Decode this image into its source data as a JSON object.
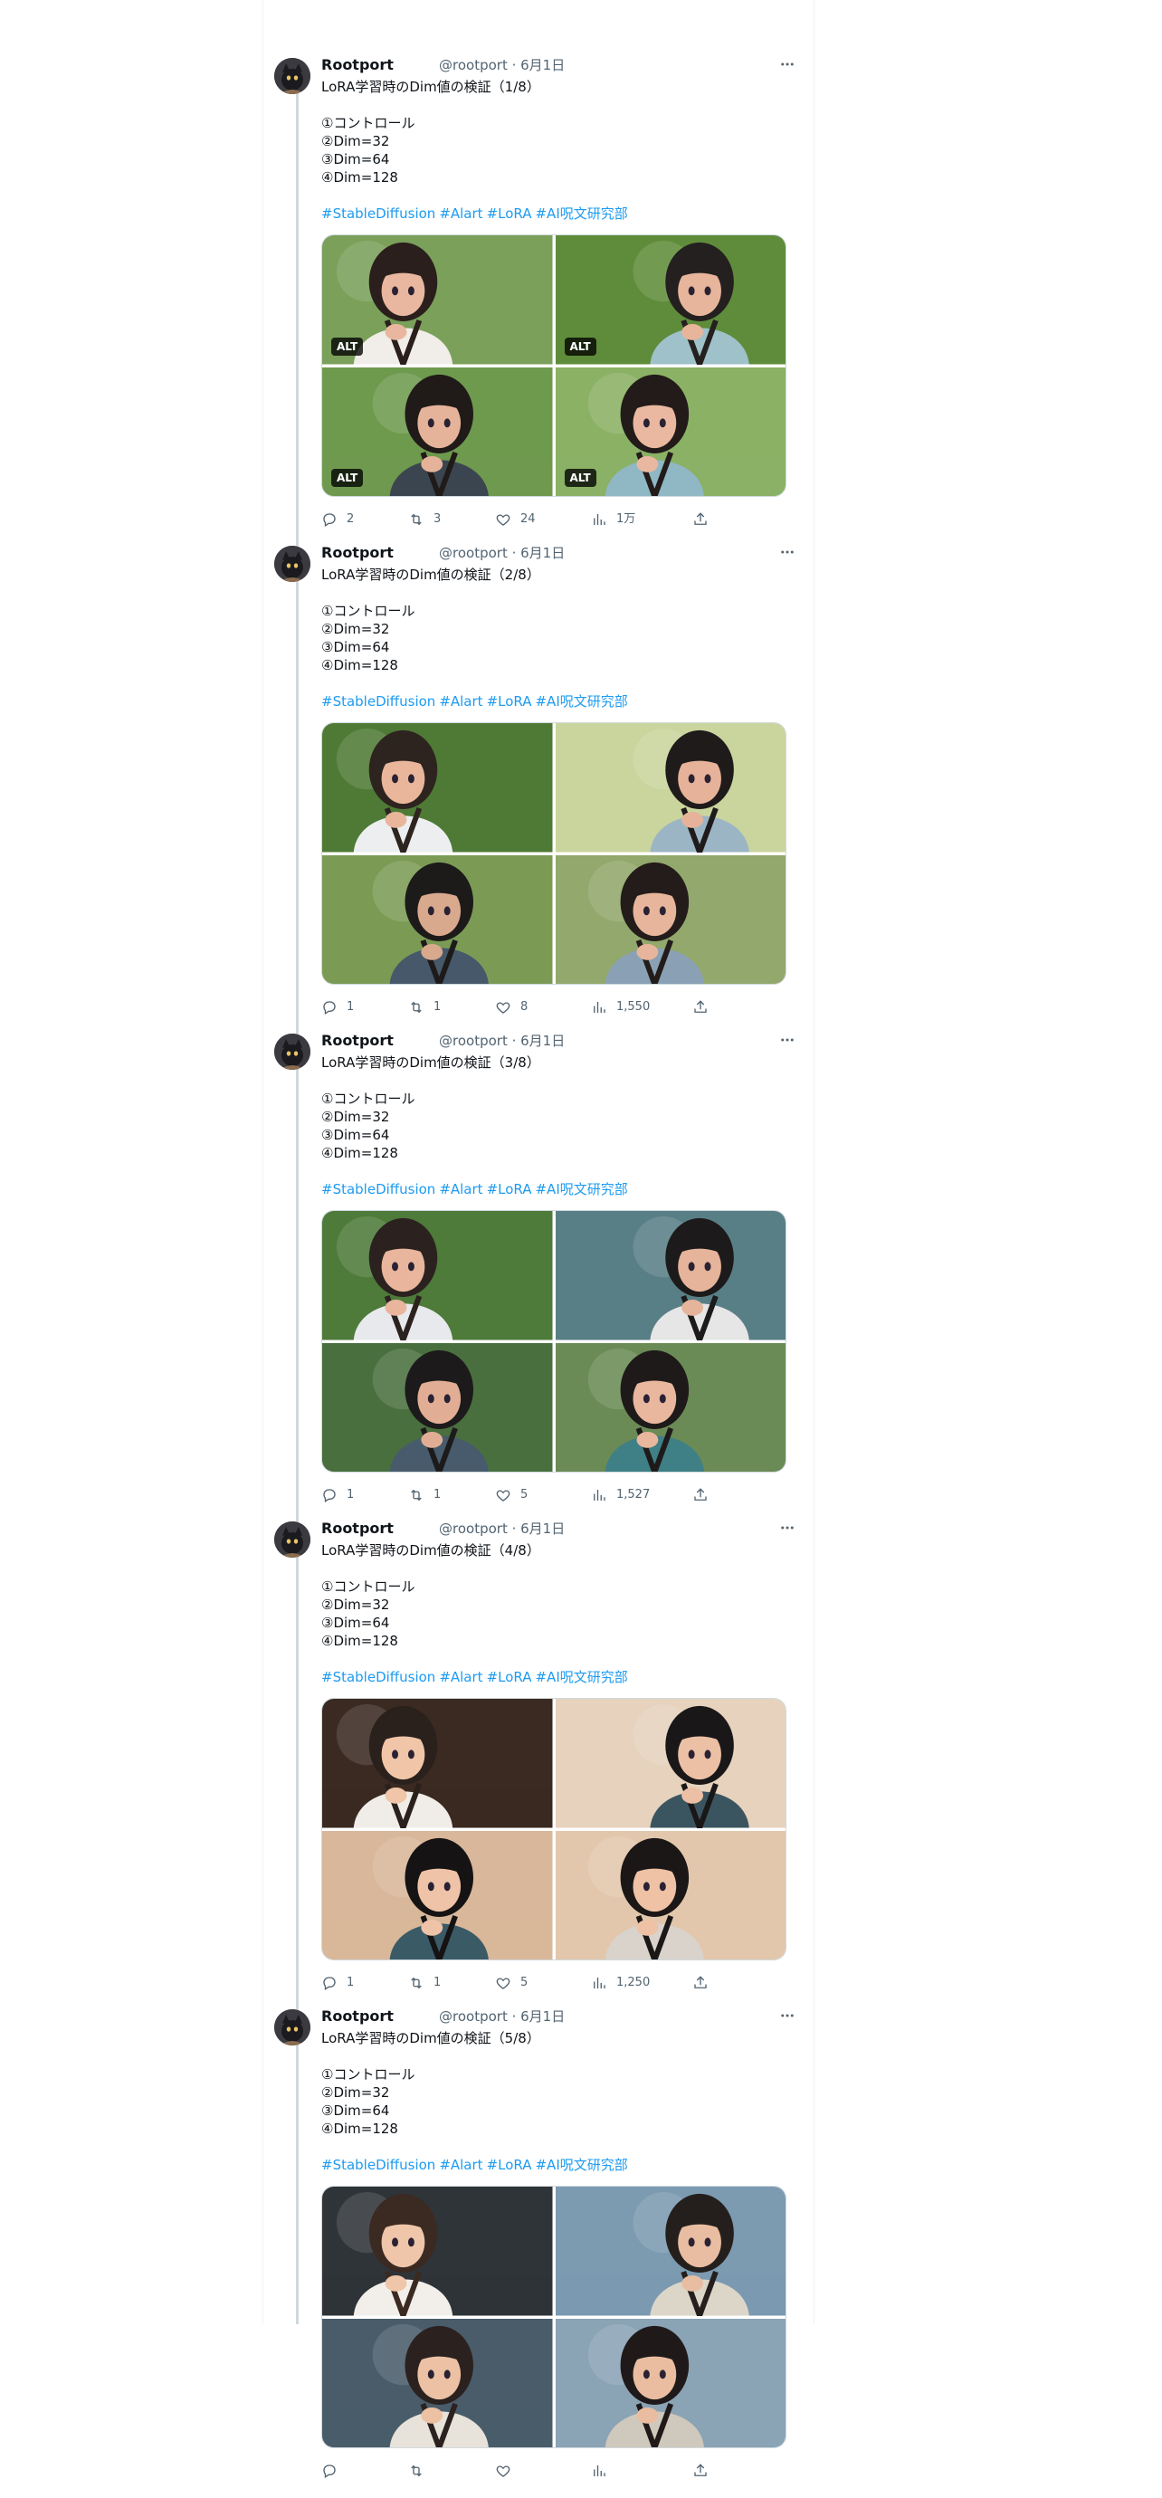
{
  "author": {
    "name": "Rootport",
    "handle": "@rootport",
    "date": "6月1日"
  },
  "hashtags": [
    "#StableDiffusion",
    "#Alart",
    "#LoRA",
    "#AI呪文研究部"
  ],
  "alt_badge": "ALT",
  "tweets": [
    {
      "title": "LoRA学習時のDim値の検証（1/8）",
      "lines": [
        "①コントロール",
        "②Dim=32",
        "③Dim=64",
        "④Dim=128"
      ],
      "has_alt": true,
      "stats": {
        "replies": "2",
        "retweets": "3",
        "likes": "24",
        "views": "1万"
      },
      "palette": [
        [
          "#7aa05a",
          "#f1ede8",
          "#2a1f1c",
          "#e9b79f"
        ],
        [
          "#5f8c3a",
          "#9fc1c9",
          "#24201f",
          "#e7b59c"
        ],
        [
          "#6e9a4e",
          "#3b4550",
          "#201a18",
          "#e4b399"
        ],
        [
          "#8bb165",
          "#90b7c4",
          "#221b19",
          "#eab8a0"
        ]
      ]
    },
    {
      "title": "LoRA学習時のDim値の検証（2/8）",
      "lines": [
        "①コントロール",
        "②Dim=32",
        "③Dim=64",
        "④Dim=128"
      ],
      "has_alt": false,
      "stats": {
        "replies": "1",
        "retweets": "1",
        "likes": "8",
        "views": "1,550"
      },
      "palette": [
        [
          "#4f7a35",
          "#eceef0",
          "#2d2420",
          "#eab69b"
        ],
        [
          "#c9d59d",
          "#9cb5c5",
          "#1f1b1b",
          "#e6b39a"
        ],
        [
          "#7b9b55",
          "#46586a",
          "#1d1a1a",
          "#d9a98e"
        ],
        [
          "#92a86c",
          "#8aa1b5",
          "#231c1a",
          "#e7b59b"
        ]
      ]
    },
    {
      "title": "LoRA学習時のDim値の検証（3/8）",
      "lines": [
        "①コントロール",
        "②Dim=32",
        "③Dim=64",
        "④Dim=128"
      ],
      "has_alt": false,
      "stats": {
        "replies": "1",
        "retweets": "1",
        "likes": "5",
        "views": "1,527"
      },
      "palette": [
        [
          "#4e7a3a",
          "#e7e9ec",
          "#2b2220",
          "#e9b69d"
        ],
        [
          "#597f86",
          "#e6e6e6",
          "#1c1a1a",
          "#e5b49a"
        ],
        [
          "#4a6f3f",
          "#475b6c",
          "#1c1a1a",
          "#e1ae95"
        ],
        [
          "#6a8b56",
          "#3f7f86",
          "#1e1a19",
          "#e8b79e"
        ]
      ]
    },
    {
      "title": "LoRA学習時のDim値の検証（4/8）",
      "lines": [
        "①コントロール",
        "②Dim=32",
        "③Dim=64",
        "④Dim=128"
      ],
      "has_alt": false,
      "stats": {
        "replies": "1",
        "retweets": "1",
        "likes": "5",
        "views": "1,250"
      },
      "palette": [
        [
          "#3b2a22",
          "#f0ece8",
          "#2a201c",
          "#f0c5a8"
        ],
        [
          "#e6d2bd",
          "#3b5560",
          "#1a1718",
          "#ecc0a5"
        ],
        [
          "#d9b79a",
          "#3a5a66",
          "#151314",
          "#eec3a8"
        ],
        [
          "#e2c7ac",
          "#d9d3cc",
          "#1b1716",
          "#efc2a6"
        ]
      ]
    },
    {
      "title": "LoRA学習時のDim値の検証（5/8）",
      "lines": [
        "①コントロール",
        "②Dim=32",
        "③Dim=64",
        "④Dim=128"
      ],
      "has_alt": false,
      "stats": {
        "replies": "",
        "retweets": "",
        "likes": "",
        "views": ""
      },
      "palette": [
        [
          "#2f3438",
          "#f2efea",
          "#3a2a22",
          "#efc6a9"
        ],
        [
          "#7c9ab0",
          "#dcd6c8",
          "#241f1d",
          "#e9bda2"
        ],
        [
          "#4a5c6a",
          "#e8e3da",
          "#2b2220",
          "#ecc1a4"
        ],
        [
          "#8aa3b5",
          "#cfc8bc",
          "#1f1a19",
          "#eabda1"
        ]
      ]
    }
  ]
}
